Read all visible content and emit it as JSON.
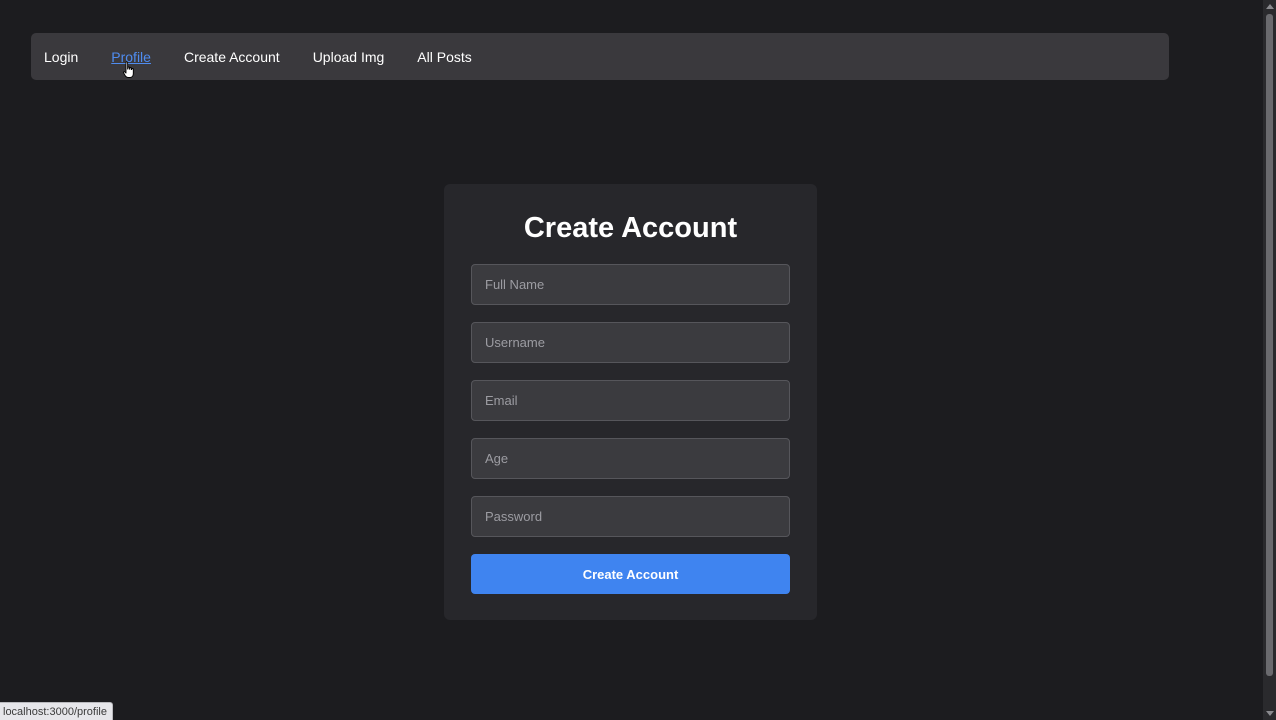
{
  "nav": {
    "items": [
      {
        "label": "Login"
      },
      {
        "label": "Profile"
      },
      {
        "label": "Create Account"
      },
      {
        "label": "Upload Img"
      },
      {
        "label": "All Posts"
      }
    ],
    "hovered_item": "Profile"
  },
  "form": {
    "title": "Create Account",
    "fields": [
      {
        "placeholder": "Full Name",
        "value": ""
      },
      {
        "placeholder": "Username",
        "value": ""
      },
      {
        "placeholder": "Email",
        "value": ""
      },
      {
        "placeholder": "Age",
        "value": ""
      },
      {
        "placeholder": "Password",
        "value": ""
      }
    ],
    "submit_label": "Create Account"
  },
  "status_bar": {
    "url": "localhost:3000/profile"
  },
  "colors": {
    "page_background": "#1c1c1f",
    "navbar_background": "#3a393d",
    "card_background": "#27272b",
    "field_background": "#3b3b3f",
    "accent": "#3f84f0",
    "link_hover": "#4f8cf0"
  },
  "icons": {
    "cursor": "hand-pointer-icon"
  }
}
